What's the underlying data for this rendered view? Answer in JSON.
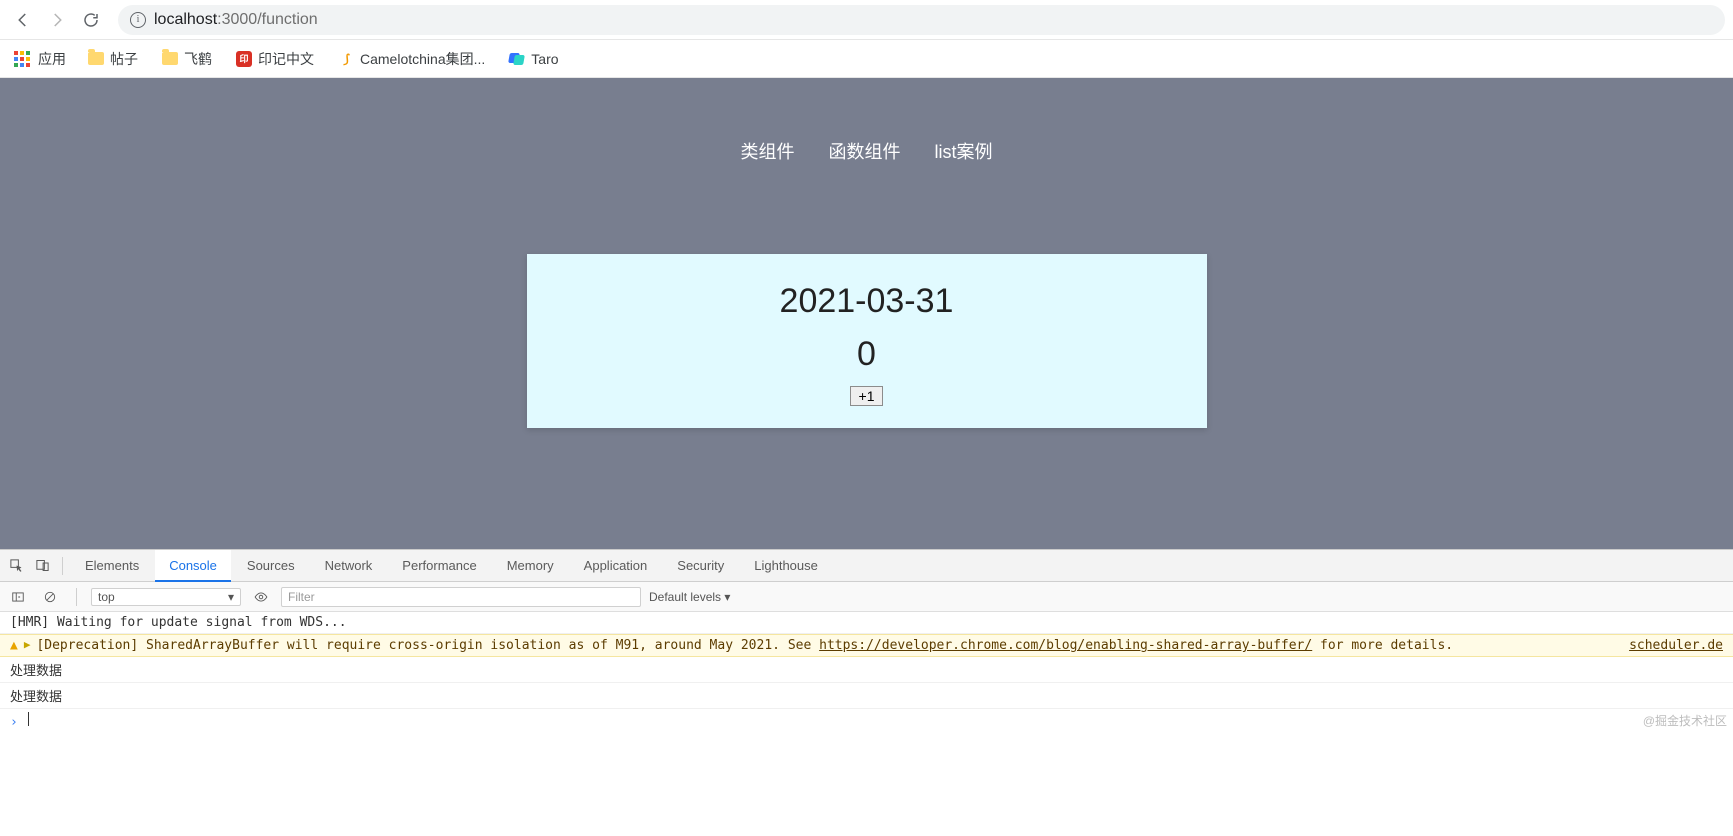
{
  "browser": {
    "url_host": "localhost",
    "url_port_path": ":3000/function",
    "apps_label": "应用",
    "bookmarks": [
      {
        "label": "帖子",
        "icon": "folder"
      },
      {
        "label": "飞鹤",
        "icon": "folder"
      },
      {
        "label": "印记中文",
        "icon": "red-square",
        "glyph": "印"
      },
      {
        "label": "Camelotchina集团...",
        "icon": "camelot",
        "glyph": "⟆"
      },
      {
        "label": "Taro",
        "icon": "taro"
      }
    ]
  },
  "page": {
    "nav": [
      "类组件",
      "函数组件",
      "list案例"
    ],
    "card": {
      "date": "2021-03-31",
      "count": "0",
      "button_label": "+1"
    }
  },
  "devtools": {
    "tabs": [
      "Elements",
      "Console",
      "Sources",
      "Network",
      "Performance",
      "Memory",
      "Application",
      "Security",
      "Lighthouse"
    ],
    "active_tab": "Console",
    "filter": {
      "context": "top",
      "filter_placeholder": "Filter",
      "levels_label": "Default levels ▾"
    },
    "logs": [
      {
        "type": "log",
        "text": "[HMR] Waiting for update signal from WDS..."
      },
      {
        "type": "warn",
        "text_prefix": "[Deprecation] SharedArrayBuffer will require cross-origin isolation as of M91, around May 2021. See ",
        "link": "https://developer.chrome.com/blog/enabling-shared-array-buffer/",
        "text_suffix": " for more details.",
        "source": "scheduler.de"
      },
      {
        "type": "log",
        "text": "处理数据"
      },
      {
        "type": "log",
        "text": "处理数据"
      }
    ]
  },
  "watermark": "@掘金技术社区"
}
